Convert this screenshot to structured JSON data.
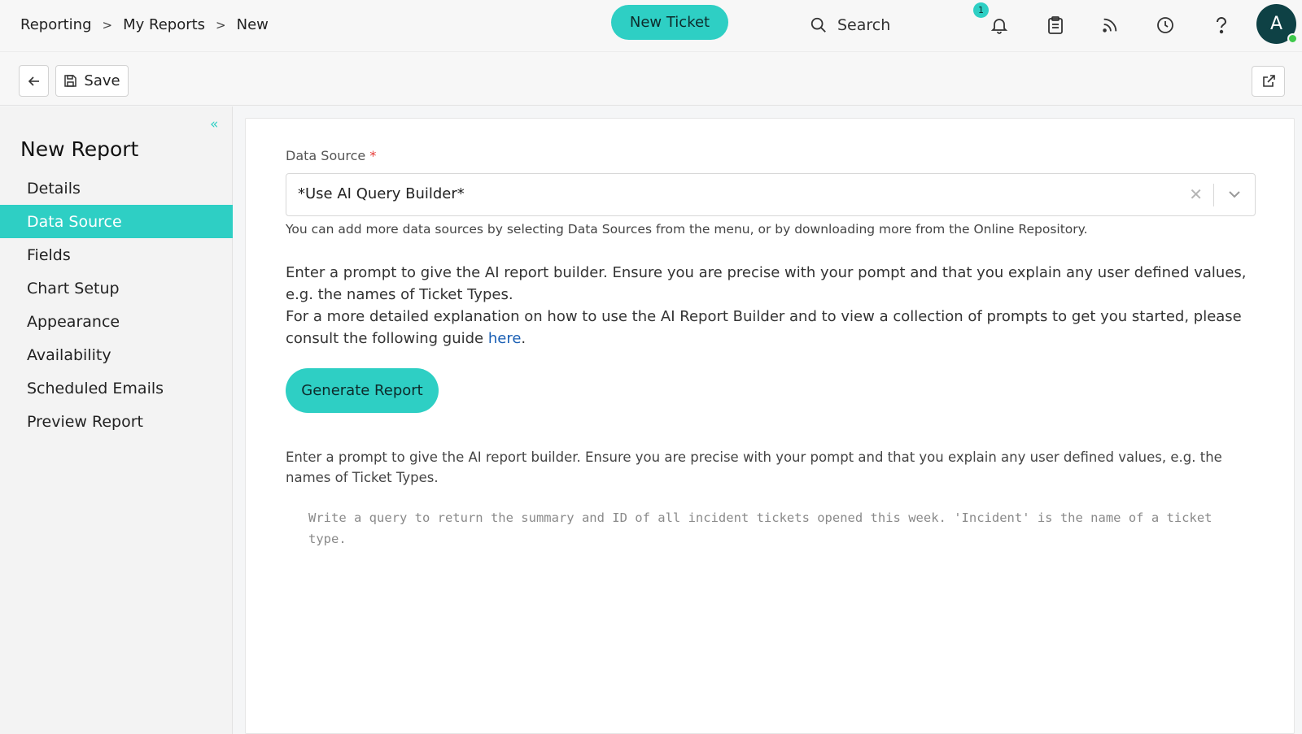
{
  "breadcrumb": {
    "items": [
      "Reporting",
      "My Reports",
      "New"
    ],
    "separator": ">"
  },
  "header": {
    "new_ticket_label": "New Ticket",
    "search_label": "Search",
    "notification_count": "1",
    "avatar_letter": "A"
  },
  "toolbar": {
    "save_label": "Save"
  },
  "sidebar": {
    "title": "New Report",
    "items": [
      {
        "label": "Details"
      },
      {
        "label": "Data Source",
        "active": true
      },
      {
        "label": "Fields"
      },
      {
        "label": "Chart Setup"
      },
      {
        "label": "Appearance"
      },
      {
        "label": "Availability"
      },
      {
        "label": "Scheduled Emails"
      },
      {
        "label": "Preview Report"
      }
    ]
  },
  "main": {
    "data_source_label": "Data Source",
    "required_mark": "*",
    "data_source_value": "*Use AI Query Builder*",
    "helper_text": "You can add more data sources by selecting Data Sources from the menu, or by downloading more from the Online Repository.",
    "prompt_intro": "Enter a prompt to give the AI report builder. Ensure you are precise with your pompt and that you explain any user defined values, e.g. the names of Ticket Types.",
    "guide_text": "For a more detailed explanation on how to use the AI Report Builder and to view a collection of prompts to get you started, please consult the following guide",
    "guide_link": "here",
    "guide_period": ".",
    "generate_label": "Generate Report",
    "prompt_description": "Enter a prompt to give the AI report builder. Ensure you are precise with your pompt and that you explain any user defined values, e.g. the names of Ticket Types.",
    "prompt_placeholder": "Write a query to return the summary and ID of all incident tickets opened this week. 'Incident' is the name of a ticket type."
  },
  "colors": {
    "accent": "#2ecfc4",
    "avatar": "#0e4145",
    "link": "#1a5fb4",
    "status_online": "#3ec94b"
  }
}
